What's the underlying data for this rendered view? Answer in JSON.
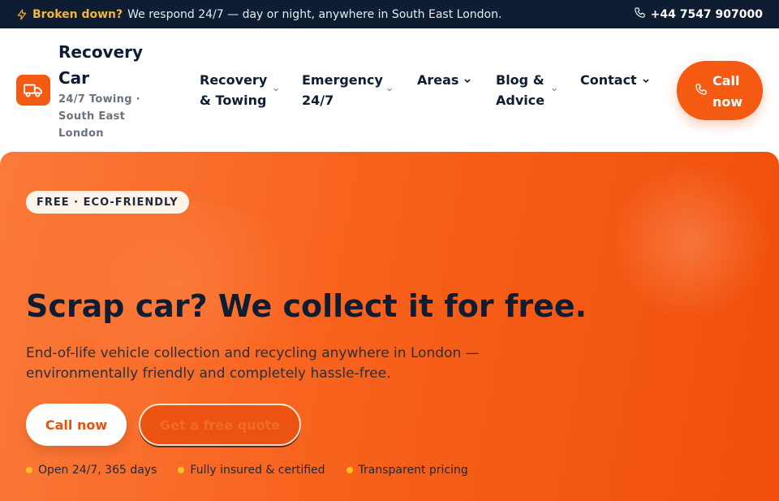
{
  "topbar": {
    "alert": "Broken down?",
    "message": "We respond 24/7 — day or night, anywhere in South East London.",
    "phone": "+44 7547 907000",
    "alert_icon": "bolt-icon",
    "phone_icon": "phone-icon"
  },
  "brand": {
    "name": "Recovery Car",
    "tagline": "24/7 Towing · South East London",
    "logo_icon": "truck-icon"
  },
  "nav": {
    "items": [
      {
        "label": "Recovery & Towing"
      },
      {
        "label": "Emergency 24/7"
      },
      {
        "label": "Areas"
      },
      {
        "label": "Blog & Advice"
      },
      {
        "label": "Contact"
      }
    ]
  },
  "header_cta": {
    "label": "Call now",
    "icon": "phone-icon"
  },
  "hero": {
    "badge": "FREE · ECO-FRIENDLY",
    "title": "Scrap car? We collect it for free.",
    "subtitle": "End-of-life vehicle collection and recycling anywhere in London — environmentally friendly and completely hassle-free.",
    "primary_button": "Call now",
    "secondary_button": "Get a free quote",
    "features": [
      "Open 24/7, 365 days",
      "Fully insured & certified",
      "Transparent pricing"
    ]
  },
  "colors": {
    "accent": "#f45a12",
    "topbar_bg": "#0f1d33",
    "alert": "#f5b53a",
    "feature_dot": "#fbbf24"
  }
}
